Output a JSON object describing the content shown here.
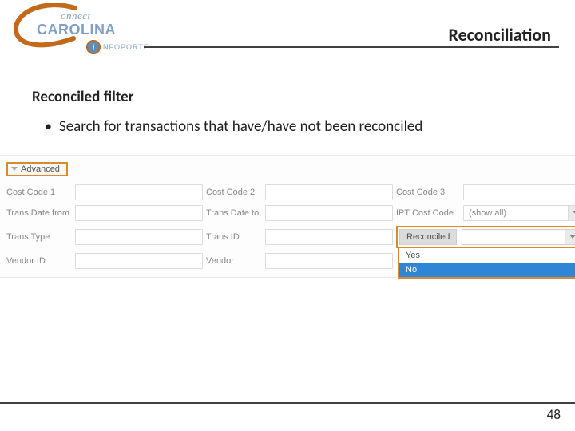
{
  "header": {
    "logo_connect": "onnect",
    "logo_carolina": "CAROLINA",
    "logo_info": "NFOPORTE",
    "title": "Reconciliation"
  },
  "content": {
    "subhead": "Reconciled filter",
    "bullet": "Search for transactions that have/have not been reconciled"
  },
  "form": {
    "advanced_label": "Advanced",
    "rows": {
      "cost_code_1": "Cost Code 1",
      "cost_code_2": "Cost Code 2",
      "cost_code_3": "Cost Code 3",
      "trans_date_from": "Trans Date from",
      "trans_date_to": "Trans Date to",
      "ipt_cost_code": "IPT Cost Code",
      "ipt_cost_value": "(show all)",
      "trans_type": "Trans Type",
      "trans_id": "Trans ID",
      "reconciled_label": "Reconciled",
      "vendor_id": "Vendor ID",
      "vendor": "Vendor"
    },
    "dropdown": {
      "opt_yes": "Yes",
      "opt_no": "No"
    }
  },
  "page_number": "48"
}
